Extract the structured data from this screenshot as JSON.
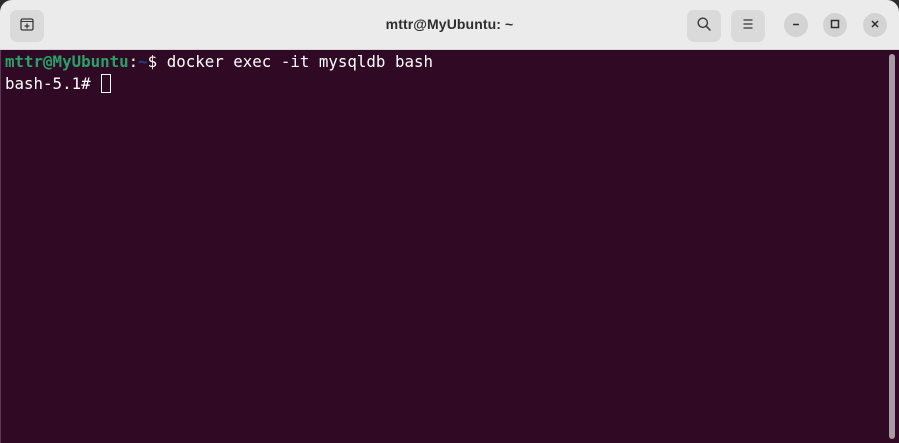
{
  "window": {
    "title": "mttr@MyUbuntu: ~"
  },
  "header": {
    "new_tab_icon": "new-tab-icon",
    "search_icon": "search-icon",
    "menu_icon": "hamburger-menu-icon",
    "minimize_icon": "minimize-icon",
    "maximize_icon": "maximize-icon",
    "close_icon": "close-icon"
  },
  "terminal": {
    "background": "#300a24",
    "line1": {
      "user_host": "mttr@MyUbuntu",
      "colon": ":",
      "cwd": "~",
      "prompt_symbol": "$ ",
      "command": "docker exec -it mysqldb bash"
    },
    "line2": {
      "prompt": "bash-5.1# "
    }
  },
  "colors": {
    "user_host": "#26a269",
    "cwd": "#12488b",
    "text": "#ffffff",
    "header_bg": "#ebebeb"
  }
}
